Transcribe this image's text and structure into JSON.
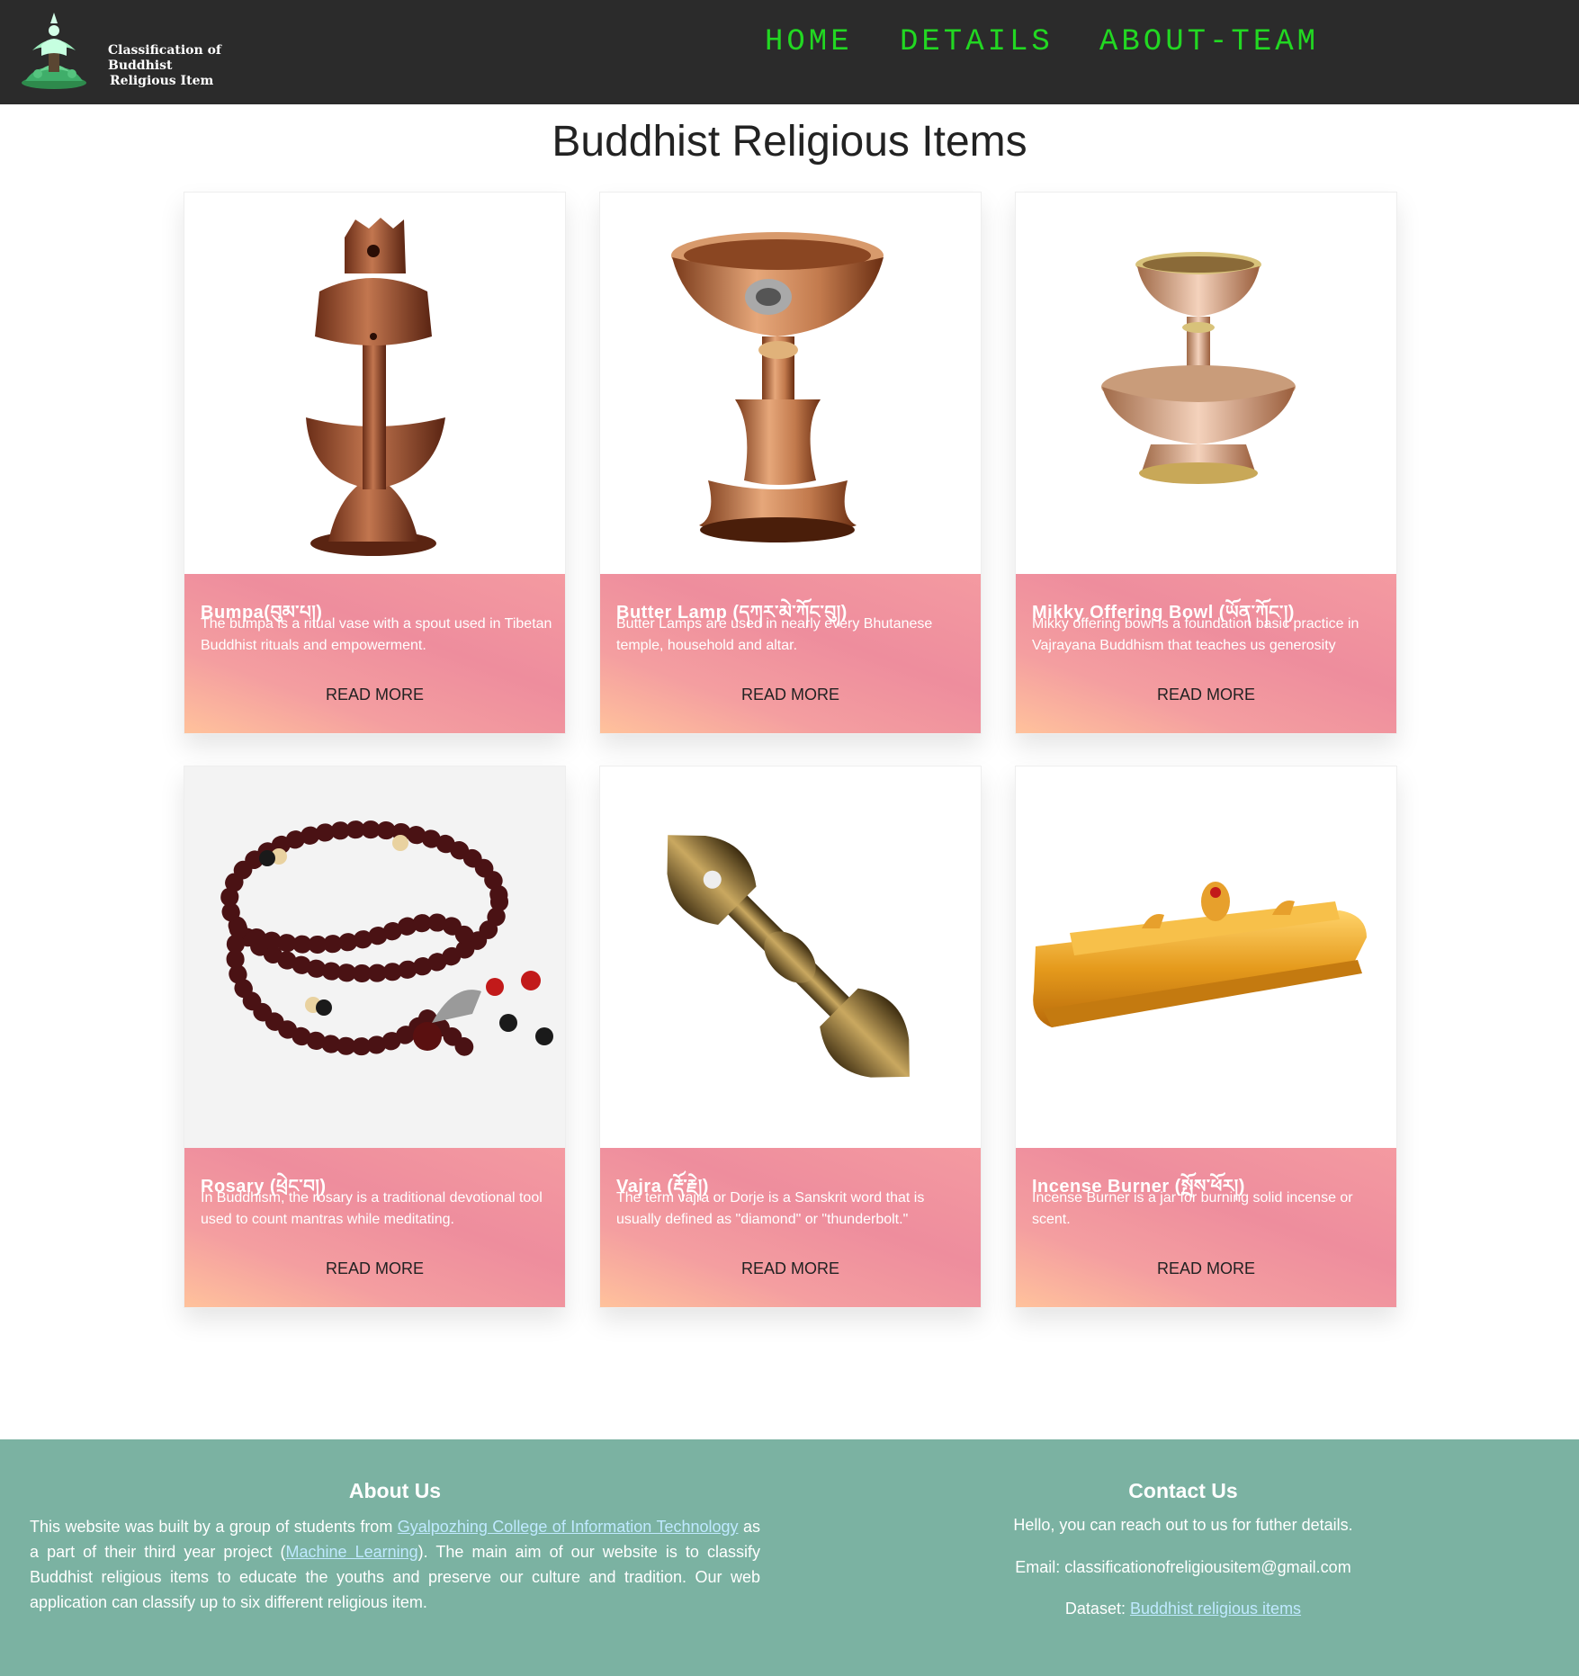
{
  "header": {
    "logo_line1": "Classification of Buddhist",
    "logo_line2": "Religious Item",
    "nav": [
      "HOME",
      "DETAILS",
      "ABOUT-TEAM"
    ]
  },
  "page_title": "Buddhist Religious Items",
  "cards": [
    {
      "title": "Bumpa(བུམ་པ།)",
      "desc": "The bumpa is a ritual vase with a spout used in Tibetan Buddhist rituals and empowerment.",
      "button": "READ MORE"
    },
    {
      "title": "Butter Lamp (དཀར་མེ་ཀོང་བུ།)",
      "desc": "Butter Lamps are used in nearly every Bhutanese temple, household and altar.",
      "button": "READ MORE"
    },
    {
      "title": "Mikky Offering Bowl (ཡོན་ཀོང་།)",
      "desc": "Mikky offering bowl is a foundation basic practice in Vajrayana Buddhism that teaches us generosity",
      "button": "READ MORE"
    },
    {
      "title": "Rosary (ཕྲེང་བ།)",
      "desc": "In Buddhism, the rosary is a traditional devotional tool used to count mantras while meditating.",
      "button": "READ MORE"
    },
    {
      "title": "Vajra (རྡོ་རྗེ།)",
      "desc": "The term vajra or Dorje is a Sanskrit word that is usually defined as \"diamond\" or \"thunderbolt.\"",
      "button": "READ MORE"
    },
    {
      "title": "Incense Burner (སྤོས་ཕོར།)",
      "desc": "Incense Burner is a jar for burning solid incense or scent.",
      "button": "READ MORE"
    }
  ],
  "footer": {
    "about": {
      "heading": "About Us",
      "text1": "This website was built by a group of students from ",
      "link1": "Gyalpozhing College of Information Technology",
      "text2": " as a part of their third year project (",
      "link2": "Machine Learning",
      "text3": "). The main aim of our website is to classify Buddhist religious items to educate the youths and preserve our culture and tradition. Our web application can classify up to six different religious item."
    },
    "contact": {
      "heading": "Contact Us",
      "line1": "Hello, you can reach out to us for futher details.",
      "email": "Email: classificationofreligiousitem@gmail.com",
      "dataset_label": "Dataset: ",
      "dataset_link": "Buddhist religious items"
    }
  },
  "colors": {
    "header_bg": "#2b2b2b",
    "nav_green": "#22d822",
    "card_gradient_pink": "#ee8d9d",
    "card_gradient_peach": "#ffc29c",
    "footer_bg": "#7bb2a2"
  }
}
